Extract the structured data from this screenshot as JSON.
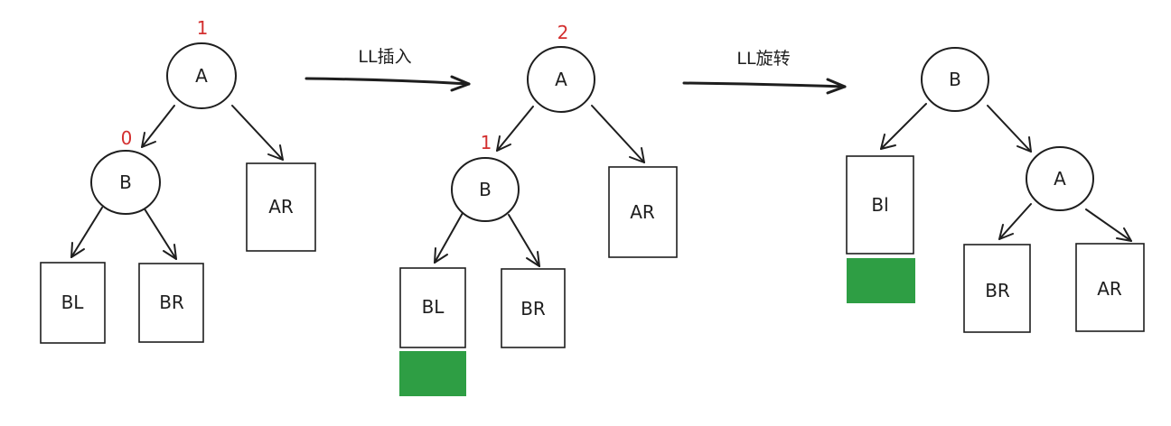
{
  "colors": {
    "stroke": "#1e1e1e",
    "balance_factor": "#d32f2f",
    "inserted_block": "#2e9e44"
  },
  "transitions": {
    "insert_label": "LL插入",
    "rotate_label": "LL旋转"
  },
  "stage1": {
    "root": "A",
    "root_bf": "1",
    "child": "B",
    "child_bf": "0",
    "right_subtree": "AR",
    "left_left": "BL",
    "left_right": "BR"
  },
  "stage2": {
    "root": "A",
    "root_bf": "2",
    "child": "B",
    "child_bf": "1",
    "right_subtree": "AR",
    "left_left": "BL",
    "left_right": "BR"
  },
  "stage3": {
    "root": "B",
    "child": "A",
    "left_subtree": "Bl",
    "child_left": "BR",
    "child_right": "AR"
  }
}
